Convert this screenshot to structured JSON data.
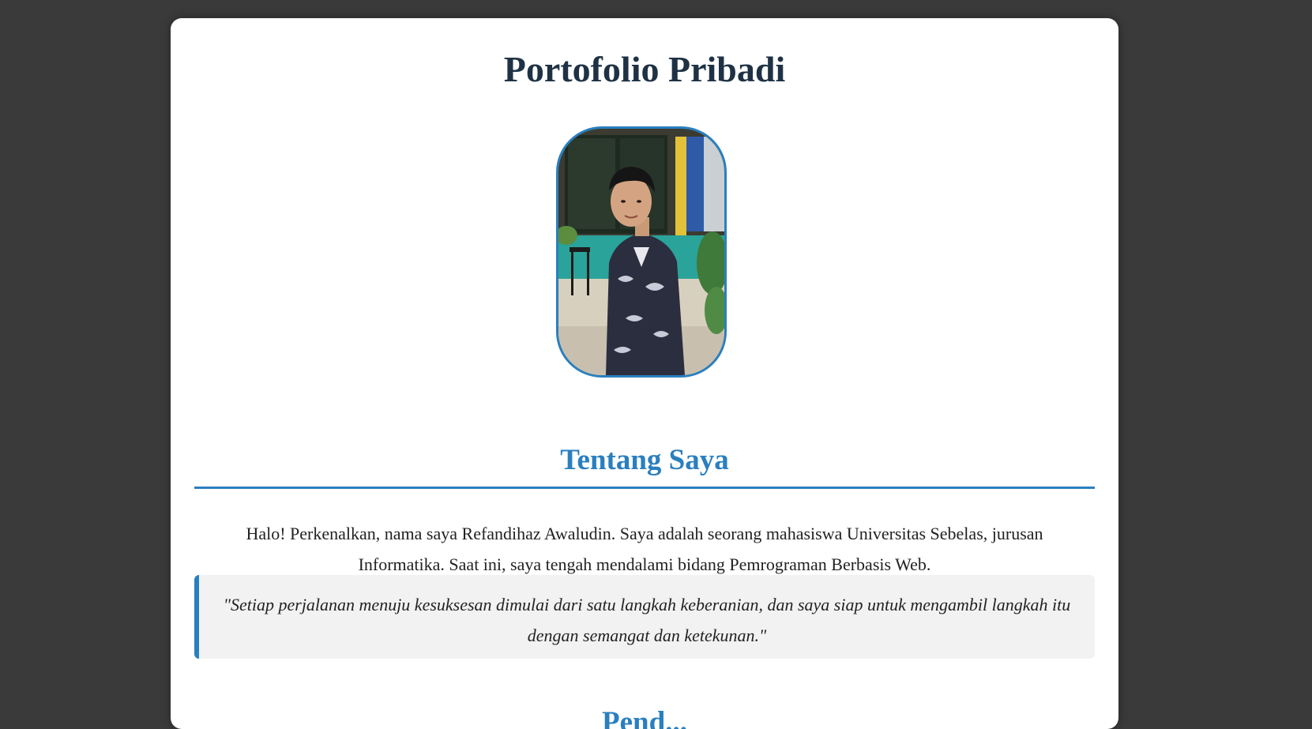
{
  "page": {
    "title": "Portofolio Pribadi"
  },
  "profile": {
    "photo_alt": "Foto profil"
  },
  "about": {
    "heading": "Tentang Saya",
    "text": "Halo! Perkenalkan, nama saya Refandihaz Awaludin. Saya adalah seorang mahasiswa Universitas Sebelas, jurusan Informatika. Saat ini, saya tengah mendalami bidang Pemrograman Berbasis Web.",
    "quote": "\"Setiap perjalanan menuju kesuksesan dimulai dari satu langkah keberanian, dan saya siap untuk mengambil langkah itu dengan semangat dan ketekunan.\""
  },
  "next_section": {
    "heading": "Pend..."
  },
  "colors": {
    "background": "#3a3a3a",
    "card": "#ffffff",
    "accent": "#2a7fbf",
    "title": "#1f3245",
    "quote_bg": "#f2f2f2"
  }
}
